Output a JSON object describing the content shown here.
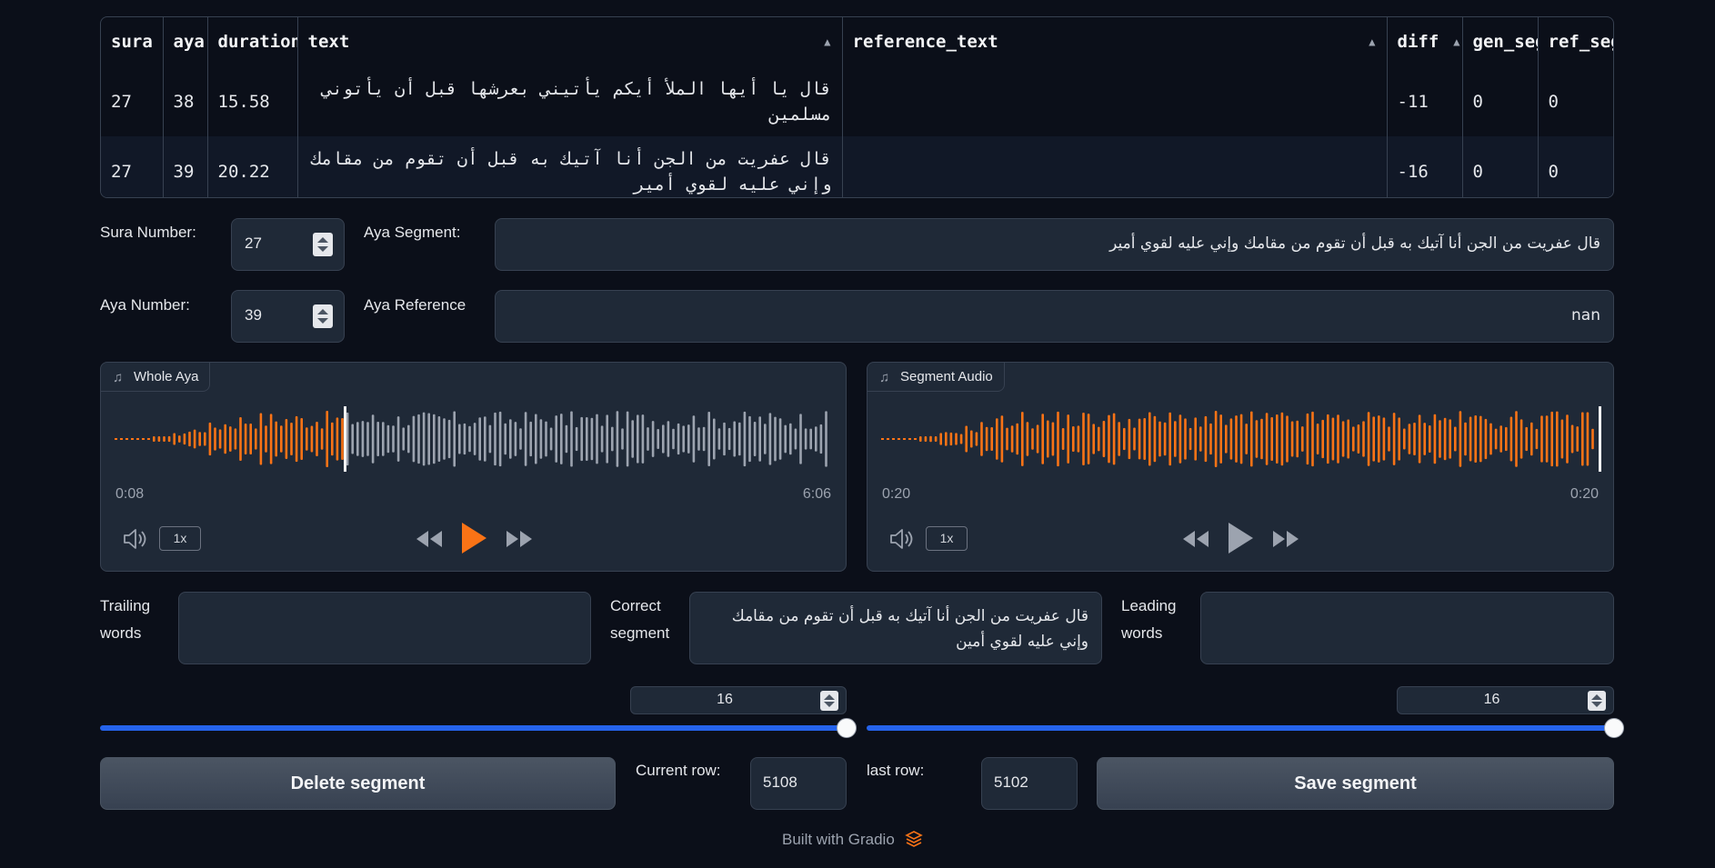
{
  "table": {
    "columns": [
      "sura",
      "aya",
      "duration",
      "text",
      "reference_text",
      "diff",
      "gen_seg",
      "ref_seg"
    ],
    "rows": [
      {
        "sura": "27",
        "aya": "38",
        "duration": "15.58",
        "text": "قال يا أيها الملأ أيكم يأتيني بعرشها قبل أن يأتوني مسلمين",
        "reference_text": "",
        "diff": "-11",
        "gen_seg": "0",
        "ref_seg": "0"
      },
      {
        "sura": "27",
        "aya": "39",
        "duration": "20.22",
        "text": "قال عفريت من الجن أنا آتيك به قبل أن تقوم من مقامك وإني عليه لقوي أمير",
        "reference_text": "",
        "diff": "-16",
        "gen_seg": "0",
        "ref_seg": "0"
      }
    ]
  },
  "form": {
    "sura_label": "Sura Number:",
    "sura_value": "27",
    "aya_label": "Aya Number:",
    "aya_value": "39",
    "segment_label": "Aya Segment:",
    "segment_value": "قال عفريت من الجن أنا آتيك به قبل أن تقوم من مقامك وإني عليه لقوي أمير",
    "reference_label": "Aya Reference",
    "reference_value": "nan"
  },
  "audio": {
    "whole": {
      "label": "Whole Aya",
      "current": "0:08",
      "total": "6:06",
      "speed": "1x",
      "progress": 0.28
    },
    "segment": {
      "label": "Segment Audio",
      "current": "0:20",
      "total": "0:20",
      "speed": "1x",
      "progress": 1.0
    }
  },
  "words": {
    "trailing_label": "Trailing words",
    "trailing_value": "",
    "correct_label": "Correct segment",
    "correct_value": "قال عفريت من الجن أنا آتيك به قبل أن تقوم من مقامك وإني عليه لقوي أمين",
    "leading_label": "Leading words",
    "leading_value": ""
  },
  "sliders": {
    "left": {
      "value": "16",
      "fraction": 1.0
    },
    "right": {
      "value": "16",
      "fraction": 1.0
    }
  },
  "actions": {
    "delete_label": "Delete segment",
    "current_row_label": "Current row:",
    "current_row_value": "5108",
    "last_row_label": "last row:",
    "last_row_value": "5102",
    "save_label": "Save segment"
  },
  "footer": {
    "text": "Built with Gradio"
  },
  "colors": {
    "accent": "#f97316",
    "slider": "#2563eb",
    "played": "#f97316",
    "unplayed": "#9ca3af"
  }
}
